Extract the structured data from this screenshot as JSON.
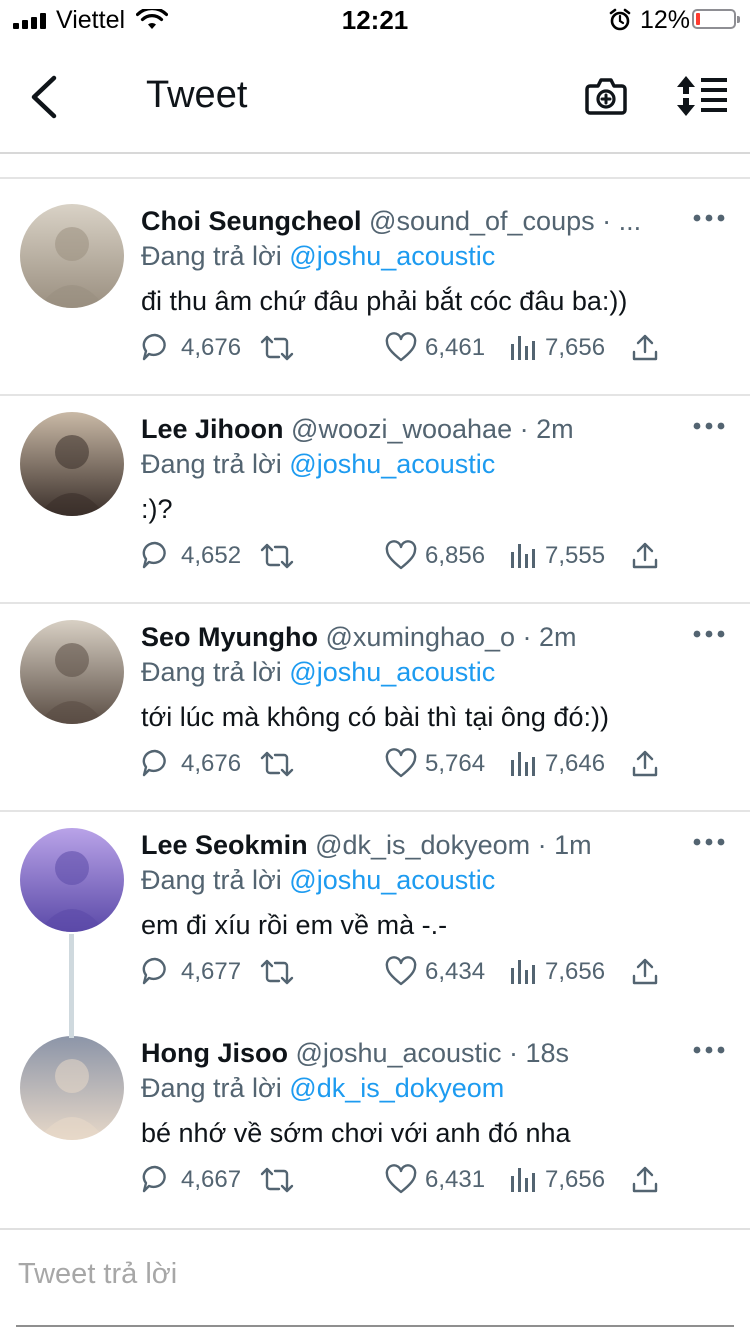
{
  "status_bar": {
    "carrier": "Viettel",
    "time": "12:21",
    "battery_percent": "12%",
    "battery_level": 0.12,
    "icons": [
      "signal-icon",
      "wifi-icon",
      "alarm-icon",
      "battery-icon"
    ]
  },
  "header": {
    "title": "Tweet",
    "icons": [
      "back-icon",
      "camera-add-icon",
      "sort-icon"
    ]
  },
  "tweets": [
    {
      "name": "Choi Seungcheol",
      "meta": "@sound_of_coups · ...",
      "replying_label": "Đang trả lời",
      "replying_to": "@joshu_acoustic",
      "text": "đi thu âm chứ đâu phải bắt cóc đâu ba:))",
      "replies": "4,676",
      "likes": "6,461",
      "views": "7,656",
      "avatar_colors": [
        "#d9d2c6",
        "#9a8f80"
      ]
    },
    {
      "name": "Lee Jihoon",
      "meta": "@woozi_wooahae · 2m",
      "replying_label": "Đang trả lời",
      "replying_to": "@joshu_acoustic",
      "text": ":)?",
      "replies": "4,652",
      "likes": "6,856",
      "views": "7,555",
      "avatar_colors": [
        "#c9b9a6",
        "#3a2f2a"
      ]
    },
    {
      "name": "Seo Myungho",
      "meta": "@xuminghao_o · 2m",
      "replying_label": "Đang trả lời",
      "replying_to": "@joshu_acoustic",
      "text": "tới lúc mà không có bài thì tại ông đó:))",
      "replies": "4,676",
      "likes": "5,764",
      "views": "7,646",
      "avatar_colors": [
        "#d8d0c4",
        "#5a4d44"
      ]
    },
    {
      "name": "Lee Seokmin",
      "meta": "@dk_is_dokyeom · 1m",
      "replying_label": "Đang trả lời",
      "replying_to": "@joshu_acoustic",
      "text": "em đi xíu rồi em về mà -.-",
      "replies": "4,677",
      "likes": "6,434",
      "views": "7,656",
      "avatar_colors": [
        "#b9a3e8",
        "#5b4aa8"
      ]
    },
    {
      "name": "Hong Jisoo",
      "meta": "@joshu_acoustic · 18s",
      "replying_label": "Đang trả lời",
      "replying_to": "@dk_is_dokyeom",
      "text": "bé nhớ về sớm chơi với anh đó nha",
      "replies": "4,667",
      "likes": "6,431",
      "views": "7,656",
      "avatar_colors": [
        "#8c95a8",
        "#e7d8c8"
      ]
    }
  ],
  "composer": {
    "placeholder": "Tweet trả lời"
  },
  "colors": {
    "accent": "#1d9bf0",
    "secondary_text": "#536471",
    "battery_low": "#ff3b30"
  }
}
